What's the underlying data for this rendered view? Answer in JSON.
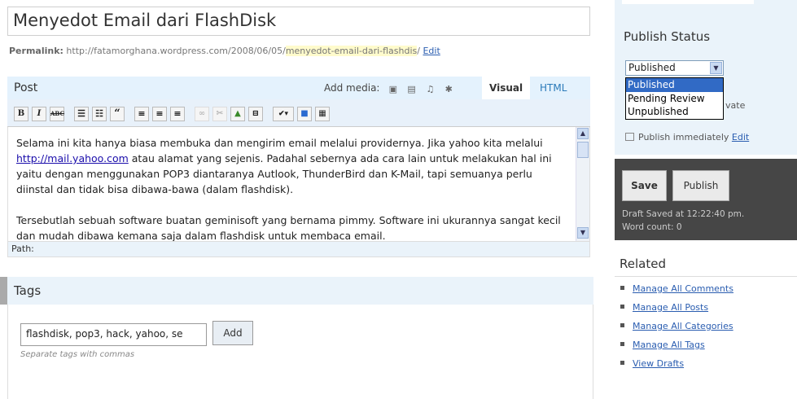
{
  "post": {
    "title": "Menyedot Email dari FlashDisk",
    "permalink_label": "Permalink:",
    "permalink_base": "http://fatamorghana.wordpress.com/2008/06/05/",
    "permalink_slug": "menyedot-email-dari-flashdis",
    "permalink_sep": "/",
    "permalink_edit": "Edit",
    "editor_label": "Post",
    "add_media_label": "Add media:",
    "tab_visual": "Visual",
    "tab_html": "HTML",
    "content": {
      "p1_before_link": "Selama ini kita hanya biasa membuka dan mengirim email melalui providernya. Jika yahoo kita melalui ",
      "p1_link": "http://mail.yahoo.com",
      "p1_after_link": " atau alamat yang sejenis. Padahal sebernya ada cara lain untuk melakukan hal ini yaitu dengan menggunakan POP3 diantaranya Autlook, ThunderBird dan K-Mail, tapi semuanya perlu diinstal dan tidak bisa dibawa-bawa (dalam flashdisk).",
      "p2": "Tersebutlah sebuah software buatan geminisoft yang bernama pimmy. Software ini ukurannya sangat kecil dan mudah dibawa kemana saja dalam flashdisk untuk membaca email."
    },
    "path_label": "Path:"
  },
  "tags": {
    "title": "Tags",
    "input_value": "flashdisk, pop3, hack, yahoo, se",
    "add_label": "Add",
    "hint": "Separate tags with commas"
  },
  "sidebar": {
    "publish_status_title": "Publish Status",
    "selected_status": "Published",
    "status_options": [
      "Published",
      "Pending Review",
      "Unpublished"
    ],
    "private_fragment": "vate",
    "publish_immediately": "Publish immediately",
    "publish_edit": "Edit",
    "save_label": "Save",
    "publish_label": "Publish",
    "draft_saved": "Draft Saved at 12:22:40 pm.",
    "word_count": "Word count: 0",
    "related_title": "Related",
    "related_links": [
      "Manage All Comments",
      "Manage All Posts",
      "Manage All Categories",
      "Manage All Tags",
      "View Drafts"
    ]
  }
}
